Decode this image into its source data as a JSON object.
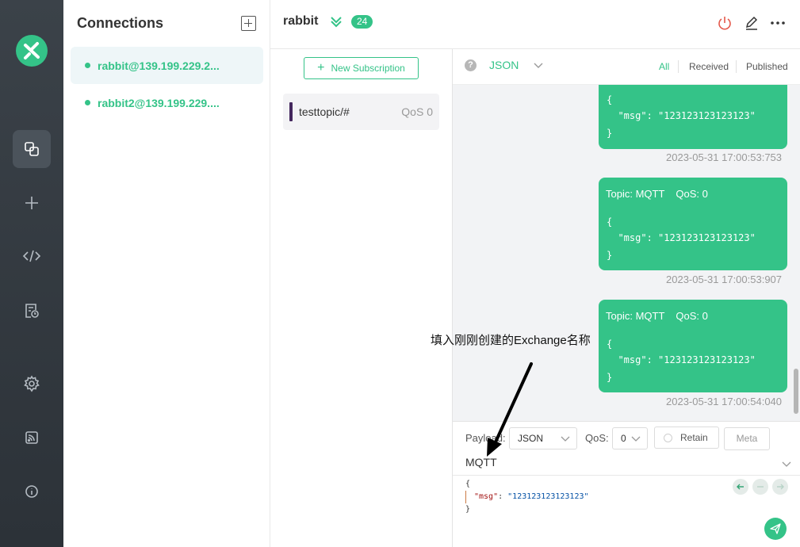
{
  "connections": {
    "title": "Connections",
    "items": [
      {
        "label": "rabbit@139.199.229.2...",
        "status": "connected"
      },
      {
        "label": "rabbit2@139.199.229....",
        "status": "connected"
      }
    ]
  },
  "topbar": {
    "name": "rabbit",
    "badge": "24"
  },
  "subscriptions": {
    "new_button": "New Subscription",
    "items": [
      {
        "topic": "testtopic/#",
        "qos": "QoS 0",
        "color": "#44275e"
      }
    ]
  },
  "message_header": {
    "help": "?",
    "format": "JSON",
    "filters": [
      "All",
      "Received",
      "Published"
    ]
  },
  "messages": [
    {
      "topic": "",
      "qos": "",
      "body": [
        "{",
        "  \"msg\": \"123123123123123\"",
        "}"
      ],
      "time": "2023-05-31 17:00:53:753"
    },
    {
      "topic": "Topic: MQTT",
      "qos": "QoS: 0",
      "body": [
        "{",
        "  \"msg\": \"123123123123123\"",
        "}"
      ],
      "time": "2023-05-31 17:00:53:907"
    },
    {
      "topic": "Topic: MQTT",
      "qos": "QoS: 0",
      "body": [
        "{",
        "  \"msg\": \"123123123123123\"",
        "}"
      ],
      "time": "2023-05-31 17:00:54:040"
    }
  ],
  "composer": {
    "payload_label": "Payload:",
    "payload_format": "JSON",
    "qos_label": "QoS:",
    "qos_value": "0",
    "retain_label": "Retain",
    "meta_label": "Meta",
    "topic_value": "MQTT",
    "editor": {
      "open": "{",
      "key": "\"msg\"",
      "colon": ": ",
      "value": "\"123123123123123\"",
      "close": "}"
    }
  },
  "annotation": {
    "text": "填入刚刚创建的Exchange名称"
  },
  "colors": {
    "accent": "#34c388",
    "rail": "#2c3238"
  }
}
